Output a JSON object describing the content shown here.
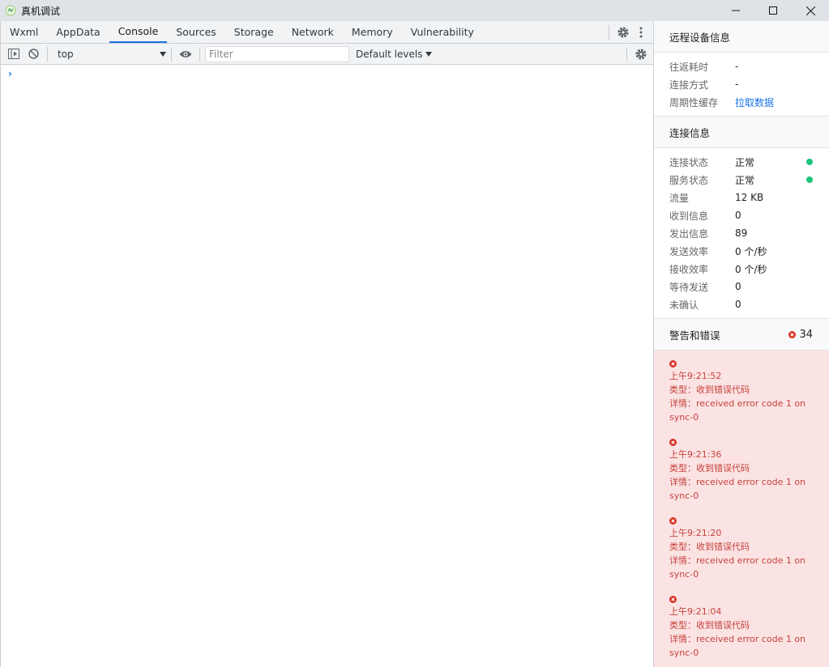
{
  "window": {
    "title": "真机调试",
    "controls": [
      "minimize-icon",
      "maximize-icon",
      "close-icon"
    ]
  },
  "devtools": {
    "tabs": [
      {
        "label": "Wxml",
        "active": false
      },
      {
        "label": "AppData",
        "active": false
      },
      {
        "label": "Console",
        "active": true
      },
      {
        "label": "Sources",
        "active": false
      },
      {
        "label": "Storage",
        "active": false
      },
      {
        "label": "Network",
        "active": false
      },
      {
        "label": "Memory",
        "active": false
      },
      {
        "label": "Vulnerability",
        "active": false
      }
    ],
    "toolbar": {
      "context": "top",
      "filter_placeholder": "Filter",
      "levels": "Default levels"
    },
    "console_prompt": "›"
  },
  "remote_device": {
    "title": "远程设备信息",
    "rows": [
      {
        "key": "往返耗时",
        "value": "-"
      },
      {
        "key": "连接方式",
        "value": "-"
      },
      {
        "key": "周期性缓存",
        "value": "拉取数据",
        "link": true
      }
    ]
  },
  "connection": {
    "title": "连接信息",
    "rows": [
      {
        "key": "连接状态",
        "value": "正常",
        "status_color": "#1ec47a"
      },
      {
        "key": "服务状态",
        "value": "正常",
        "status_color": "#1ec47a"
      },
      {
        "key": "流量",
        "value": "12 KB"
      },
      {
        "key": "收到信息",
        "value": "0"
      },
      {
        "key": "发出信息",
        "value": "89"
      },
      {
        "key": "发送效率",
        "value": "0 个/秒"
      },
      {
        "key": "接收效率",
        "value": "0 个/秒"
      },
      {
        "key": "等待发送",
        "value": "0"
      },
      {
        "key": "未确认",
        "value": "0"
      }
    ]
  },
  "warnings": {
    "title": "警告和错误",
    "count": "34",
    "items": [
      {
        "time": "上午9:21:52",
        "type": "类型：收到错误代码",
        "detail": "详情：received error code 1 on sync-0"
      },
      {
        "time": "上午9:21:36",
        "type": "类型：收到错误代码",
        "detail": "详情：received error code 1 on sync-0"
      },
      {
        "time": "上午9:21:20",
        "type": "类型：收到错误代码",
        "detail": "详情：received error code 1 on sync-0"
      },
      {
        "time": "上午9:21:04",
        "type": "类型：收到错误代码",
        "detail": "详情：received error code 1 on sync-0"
      }
    ]
  }
}
